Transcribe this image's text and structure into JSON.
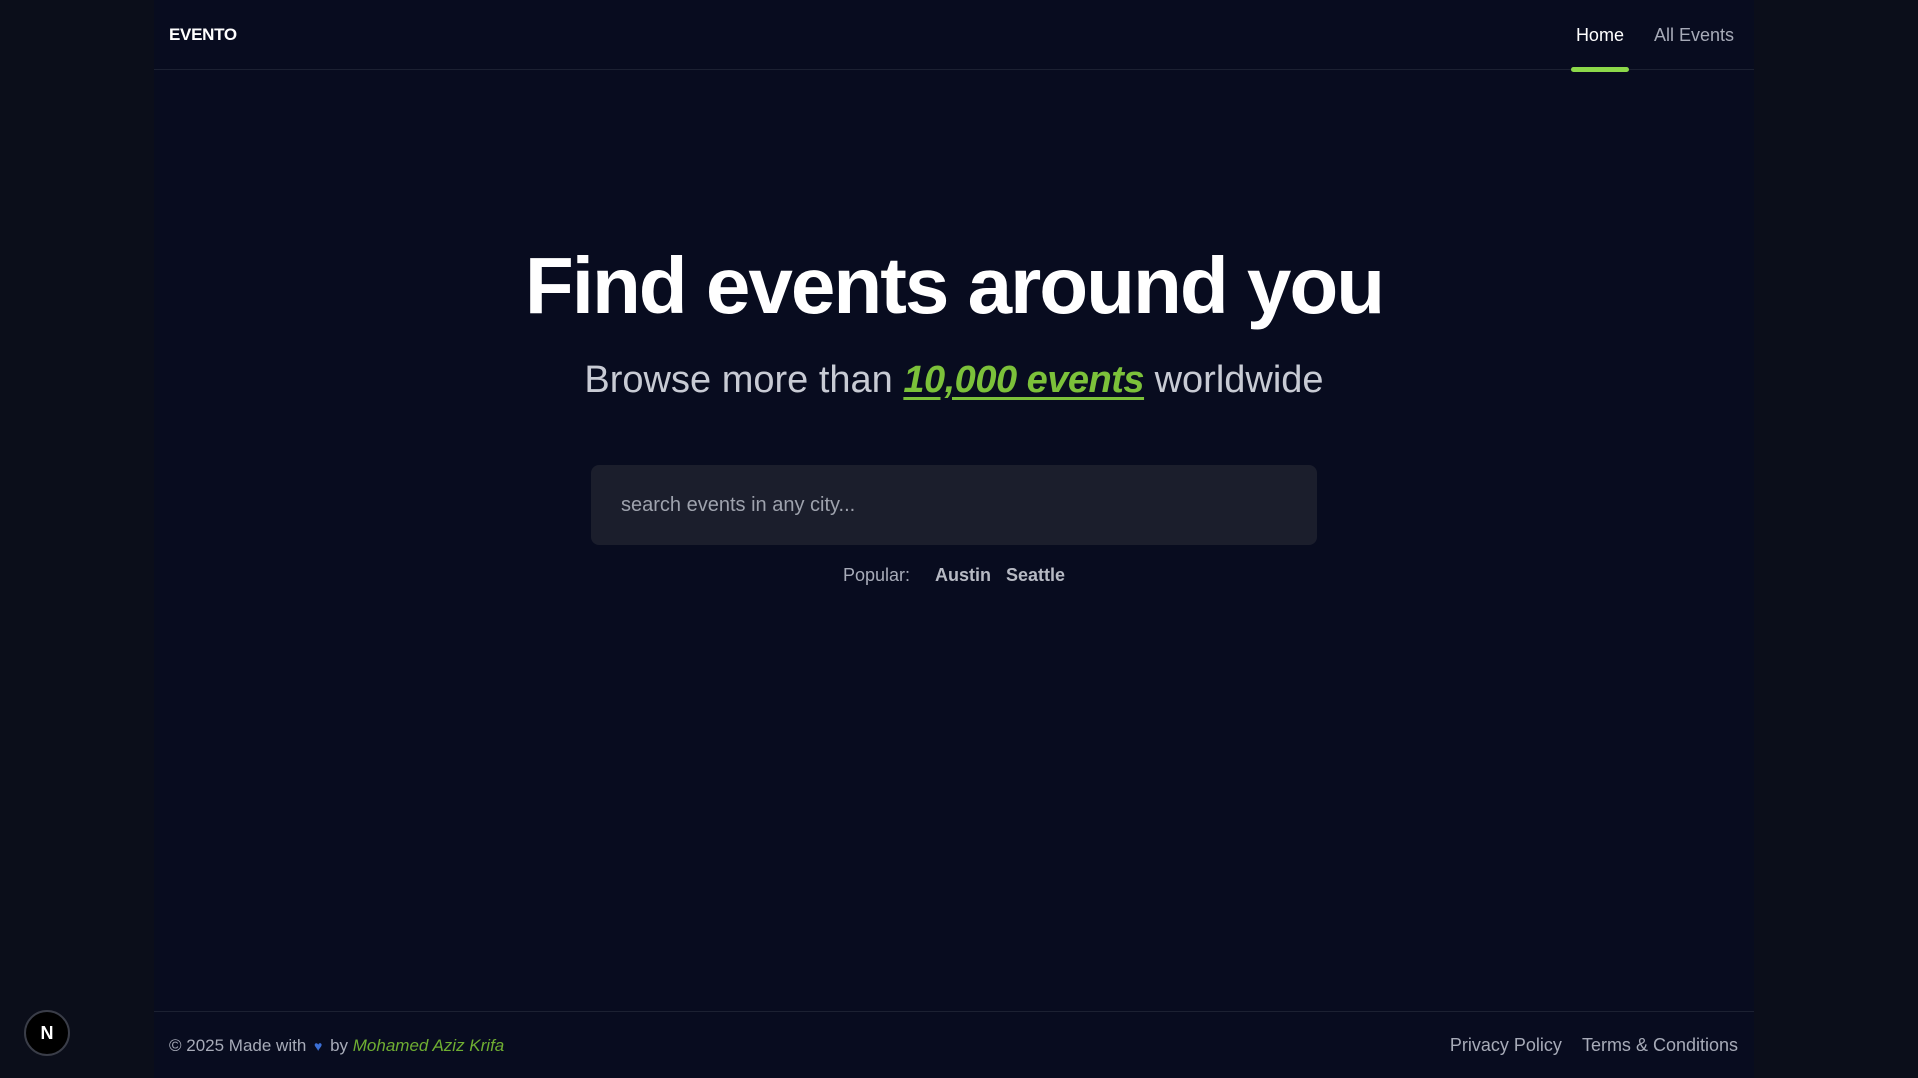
{
  "header": {
    "logo": "EVENTO",
    "nav": [
      {
        "label": "Home",
        "active": true
      },
      {
        "label": "All Events",
        "active": false
      }
    ]
  },
  "hero": {
    "title": "Find events around you",
    "subtitle_prefix": "Browse more than",
    "subtitle_highlight": "10,000 events",
    "subtitle_suffix": "worldwide"
  },
  "search": {
    "placeholder": "search events in any city...",
    "value": ""
  },
  "popular": {
    "label": "Popular:",
    "cities": [
      "Austin",
      "Seattle"
    ]
  },
  "footer": {
    "copyright": "© 2025 Made with",
    "heart_icon": "heart-icon",
    "by": "by",
    "author": "Mohamed Aziz Krifa",
    "links": [
      "Privacy Policy",
      "Terms & Conditions"
    ]
  },
  "badge": {
    "letter": "N"
  },
  "colors": {
    "accent": "#8cd94a",
    "highlight": "#7cc13a",
    "background": "#080c1f",
    "search_bg": "#1b1e2c"
  }
}
